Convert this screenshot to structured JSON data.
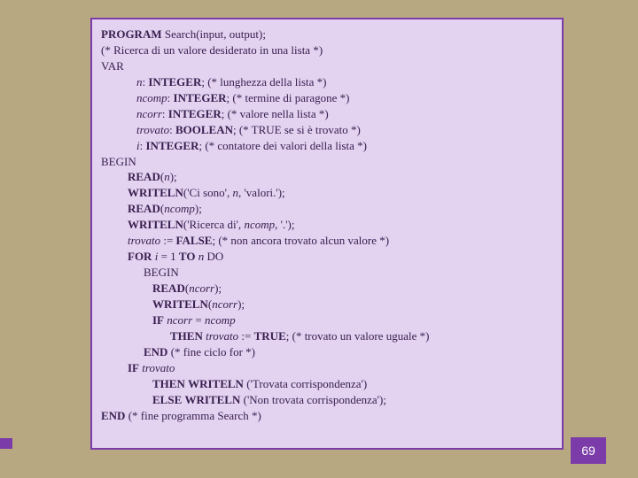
{
  "page_number": "69",
  "code": {
    "l1a": "PROGRAM",
    "l1b": " Search(input, output);",
    "l2": "(* Ricerca di un valore desiderato in una lista *)",
    "l3": "VAR",
    "l4a": "n",
    "l4b": ": ",
    "l4c": "INTEGER",
    "l4d": ";  (* lunghezza della lista *)",
    "l5a": "ncomp",
    "l5b": ": ",
    "l5c": "INTEGER",
    "l5d": ";  (* termine di paragone *)",
    "l6a": "ncorr",
    "l6b": ": ",
    "l6c": "INTEGER",
    "l6d": ";  (* valore nella lista *)",
    "l7a": "trovato",
    "l7b": ": ",
    "l7c": "BOOLEAN",
    "l7d": "; (* TRUE se si è trovato *)",
    "l8a": "i",
    "l8b": ": ",
    "l8c": "INTEGER",
    "l8d": "; (* contatore dei valori della lista *)",
    "l9": "BEGIN",
    "l10a": "READ",
    "l10b": "(",
    "l10c": "n",
    "l10d": ");",
    "l11a": "WRITELN",
    "l11b": "('Ci sono', ",
    "l11c": "n",
    "l11d": ", 'valori.');",
    "l12a": "READ",
    "l12b": "(",
    "l12c": "ncomp",
    "l12d": ");",
    "l13a": "WRITELN",
    "l13b": "('Ricerca di', ",
    "l13c": "ncomp",
    "l13d": ", '.');",
    "l14a": "trovato",
    "l14b": " := ",
    "l14c": "FALSE",
    "l14d": ";  (* non ancora trovato alcun valore *)",
    "l15a": "FOR",
    "l15b": " ",
    "l15c": "i",
    "l15d": " = 1 ",
    "l15e": "TO",
    "l15f": " ",
    "l15g": "n",
    "l15h": " DO",
    "l16": "BEGIN",
    "l17a": "READ",
    "l17b": "(",
    "l17c": "ncorr",
    "l17d": ");",
    "l18a": "WRITELN",
    "l18b": "(",
    "l18c": "ncorr",
    "l18d": ");",
    "l19a": "IF",
    "l19b": " ",
    "l19c": "ncorr",
    "l19d": " = ",
    "l19e": "ncomp",
    "l20a": "THEN",
    "l20b": " ",
    "l20c": "trovato",
    "l20d": " := ",
    "l20e": "TRUE",
    "l20f": "; (* trovato un valore uguale *)",
    "l21a": "END",
    "l21b": "  (* fine ciclo for *)",
    "l22a": "IF",
    "l22b": " ",
    "l22c": "trovato",
    "l23a": "THEN",
    "l23b": " ",
    "l23c": "WRITELN",
    "l23d": " ('Trovata corrispondenza')",
    "l24a": "ELSE",
    "l24b": " ",
    "l24c": "WRITELN",
    "l24d": " ('Non trovata corrispondenza');",
    "l25a": "END",
    "l25b": " (* fine programma Search *)"
  }
}
